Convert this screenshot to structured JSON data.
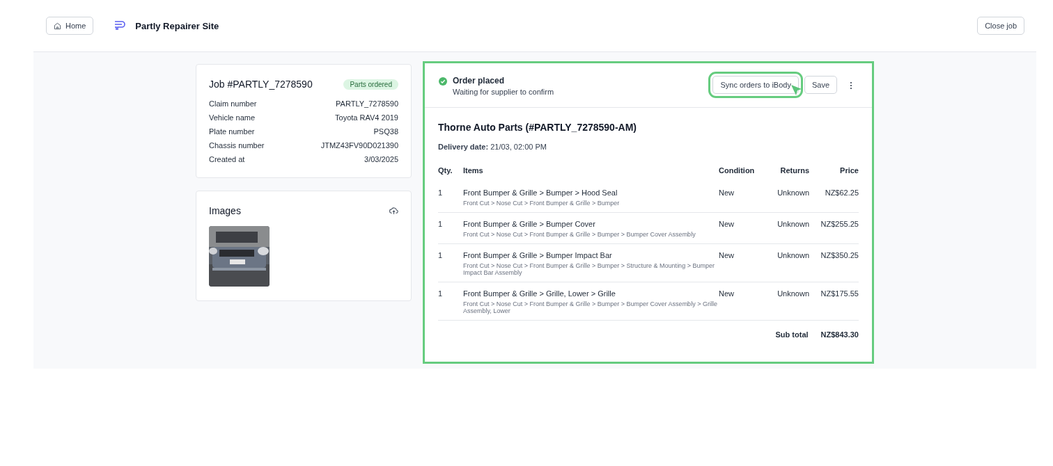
{
  "header": {
    "home_button": "Home",
    "site_title": "Partly Repairer Site",
    "close_button": "Close job"
  },
  "job": {
    "title": "Job #PARTLY_7278590",
    "status": "Parts ordered",
    "fields": [
      {
        "label": "Claim number",
        "value": "PARTLY_7278590"
      },
      {
        "label": "Vehicle name",
        "value": "Toyota RAV4 2019"
      },
      {
        "label": "Plate number",
        "value": "PSQ38"
      },
      {
        "label": "Chassis number",
        "value": "JTMZ43FV90D021390"
      },
      {
        "label": "Created at",
        "value": "3/03/2025"
      }
    ]
  },
  "images": {
    "title": "Images"
  },
  "order": {
    "highlighted": true,
    "status": "Order placed",
    "subtitle": "Waiting for supplier to confirm",
    "buttons": [
      {
        "label": "Sync orders to iBody",
        "highlighted": true
      },
      {
        "label": "Save",
        "highlighted": false
      }
    ],
    "supplier": "Thorne Auto Parts (#PARTLY_7278590-AM)",
    "delivery": "**Delivery date:** 21/03, 02:00 PM",
    "columns": [
      "Qty.",
      "Items",
      "Condition",
      "Returns",
      "Price"
    ],
    "rows": [
      {
        "qty": "1",
        "item": "Front Bumper & Grille > Bumper > Hood Seal",
        "path": "Front Cut > Nose Cut > Front Bumper & Grille > Bumper",
        "condition": "New",
        "returns": "Unknown",
        "price": "NZ$62.25"
      },
      {
        "qty": "1",
        "item": "Front Bumper & Grille > Bumper Cover",
        "path": "Front Cut > Nose Cut > Front Bumper & Grille > Bumper > Bumper Cover Assembly",
        "condition": "New",
        "returns": "Unknown",
        "price": "NZ$255.25"
      },
      {
        "qty": "1",
        "item": "Front Bumper & Grille > Bumper Impact Bar",
        "path": "Front Cut > Nose Cut > Front Bumper & Grille > Bumper > Structure & Mounting > Bumper Impact Bar Assembly",
        "condition": "New",
        "returns": "Unknown",
        "price": "NZ$350.25"
      },
      {
        "qty": "1",
        "item": "Front Bumper & Grille > Grille, Lower > Grille",
        "path": "Front Cut > Nose Cut > Front Bumper & Grille > Bumper > Bumper Cover Assembly > Grille Assembly, Lower",
        "condition": "New",
        "returns": "Unknown",
        "price": "NZ$175.55"
      }
    ],
    "subtotal_label": "Sub total",
    "subtotal": "NZ$843.30"
  }
}
